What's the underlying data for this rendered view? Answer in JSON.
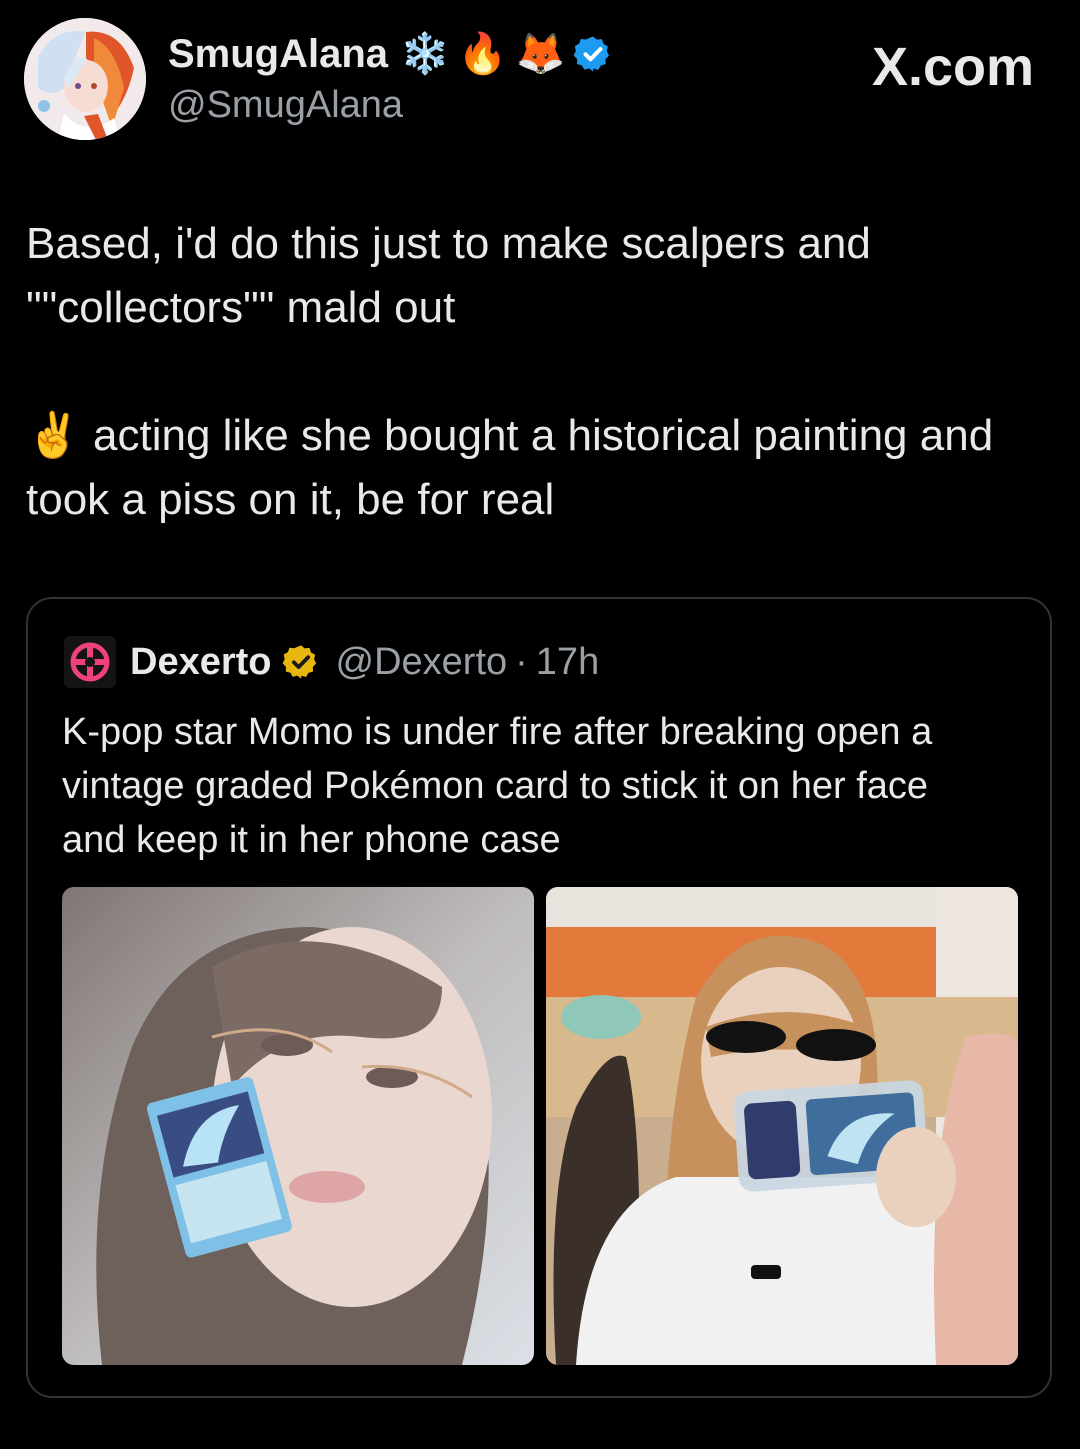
{
  "post": {
    "author": {
      "display_name": "SmugAlana",
      "name_emojis": [
        "❄️",
        "🔥",
        "🦊"
      ],
      "handle": "@SmugAlana",
      "verified": true
    },
    "site_label": "X.com",
    "text_lines": [
      "Based, i'd do this just to make scalpers and",
      "\"\"collectors\"\" mald out",
      "✌️ acting like she bought a historical painting and",
      "took a piss on it, be for real"
    ]
  },
  "quote": {
    "author": {
      "display_name": "Dexerto",
      "handle": "@Dexerto",
      "separator": "·",
      "time": "17h",
      "badge_color": "#e8b70f"
    },
    "text_lines": [
      "K-pop star Momo is under fire after breaking open a",
      "vintage graded Pokémon card to stick it on her face",
      "and keep it in her phone case"
    ],
    "images": [
      {
        "icon": "photo-icon"
      },
      {
        "icon": "photo-icon"
      }
    ]
  },
  "colors": {
    "background": "#000000",
    "text_primary": "#e7e9ea",
    "text_secondary": "#9aa0a6",
    "verified_blue": "#1d9bf0",
    "card_border": "#2f3336"
  }
}
